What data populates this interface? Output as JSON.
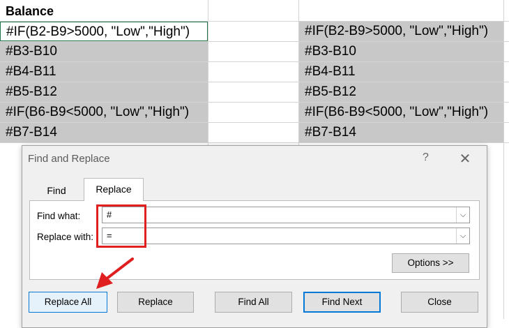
{
  "sheet": {
    "header": "Balance",
    "col_b": [
      "#IF(B2-B9>5000, \"Low\",\"High\")",
      "#B3-B10",
      "#B4-B11",
      "#B5-B12",
      "#IF(B6-B9<5000, \"Low\",\"High\")",
      "#B7-B14"
    ],
    "col_d": [
      "#IF(B2-B9>5000, \"Low\",\"High\")",
      "#B3-B10",
      "#B4-B11",
      "#B5-B12",
      "#IF(B6-B9<5000, \"Low\",\"High\")",
      "#B7-B14"
    ]
  },
  "dialog": {
    "title": "Find and Replace",
    "help": "?",
    "close": "✕",
    "tabs": {
      "find": "Find",
      "replace": "Replace"
    },
    "find_label": "Find what:",
    "find_value": "#",
    "replace_label": "Replace with:",
    "replace_value": "=",
    "dropdown_glyph": "⌵",
    "options_label": "Options >>",
    "buttons": {
      "replace_all": "Replace All",
      "replace": "Replace",
      "find_all": "Find All",
      "find_next": "Find Next",
      "close": "Close"
    }
  },
  "colors": {
    "selection": "#c8c8c8",
    "highlight": "#e02020",
    "accent": "#0078d7"
  }
}
